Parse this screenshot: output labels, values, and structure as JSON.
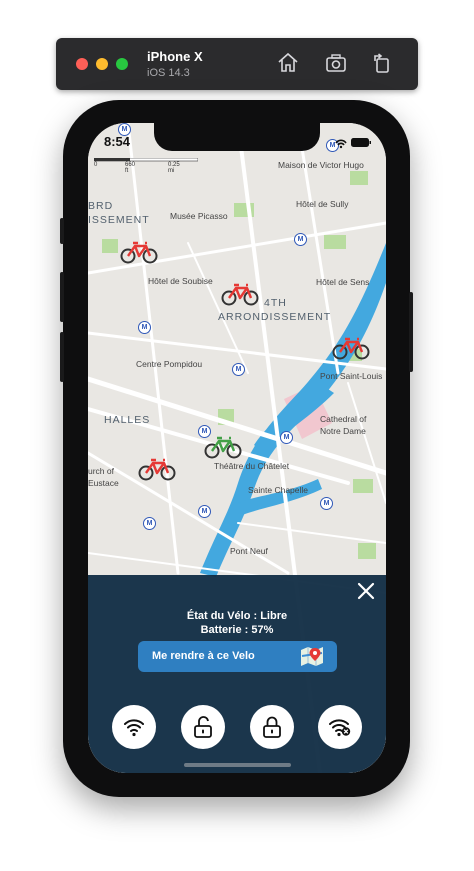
{
  "simulator": {
    "device_name": "iPhone X",
    "os_version": "iOS 14.3",
    "buttons": [
      "home-icon",
      "screenshot-icon",
      "rotate-icon"
    ]
  },
  "status_bar": {
    "time": "8:54"
  },
  "map": {
    "scale": {
      "feet": "660 ft",
      "miles": "0.25 mi"
    },
    "areas": [
      "BRD",
      "ISSEMENT",
      "4TH",
      "ARRONDISSEMENT",
      "HALLES"
    ],
    "places": [
      "Maison de Victor Hugo",
      "Hôtel de Sully",
      "Musée Picasso",
      "Hôtel de Soubise",
      "Hôtel de Sens",
      "Centre Pompidou",
      "Pont Saint-Louis",
      "Cathedral of",
      "Notre Dame",
      "Théâtre du Châtelet",
      "Sainte Chapelle",
      "urch of",
      "Eustace",
      "Pont Neuf"
    ],
    "bikes": [
      {
        "status": "occupied",
        "color": "#e53935"
      },
      {
        "status": "occupied",
        "color": "#e53935"
      },
      {
        "status": "occupied",
        "color": "#e53935"
      },
      {
        "status": "available",
        "color": "#43a047"
      },
      {
        "status": "occupied",
        "color": "#e53935"
      }
    ]
  },
  "panel": {
    "state_text": "État du Vélo : Libre",
    "battery_text": "Batterie : 57%",
    "go_button_label": "Me rendre à ce Velo",
    "actions": [
      "wifi-icon",
      "unlock-icon",
      "lock-icon",
      "wifi-off-icon"
    ]
  },
  "colors": {
    "panel_bg": "#0e2a42",
    "go_button": "#2f7fc1",
    "bike_red": "#e53935",
    "bike_green": "#43a047",
    "water": "#43a8df",
    "metro": "#2f58b8"
  }
}
